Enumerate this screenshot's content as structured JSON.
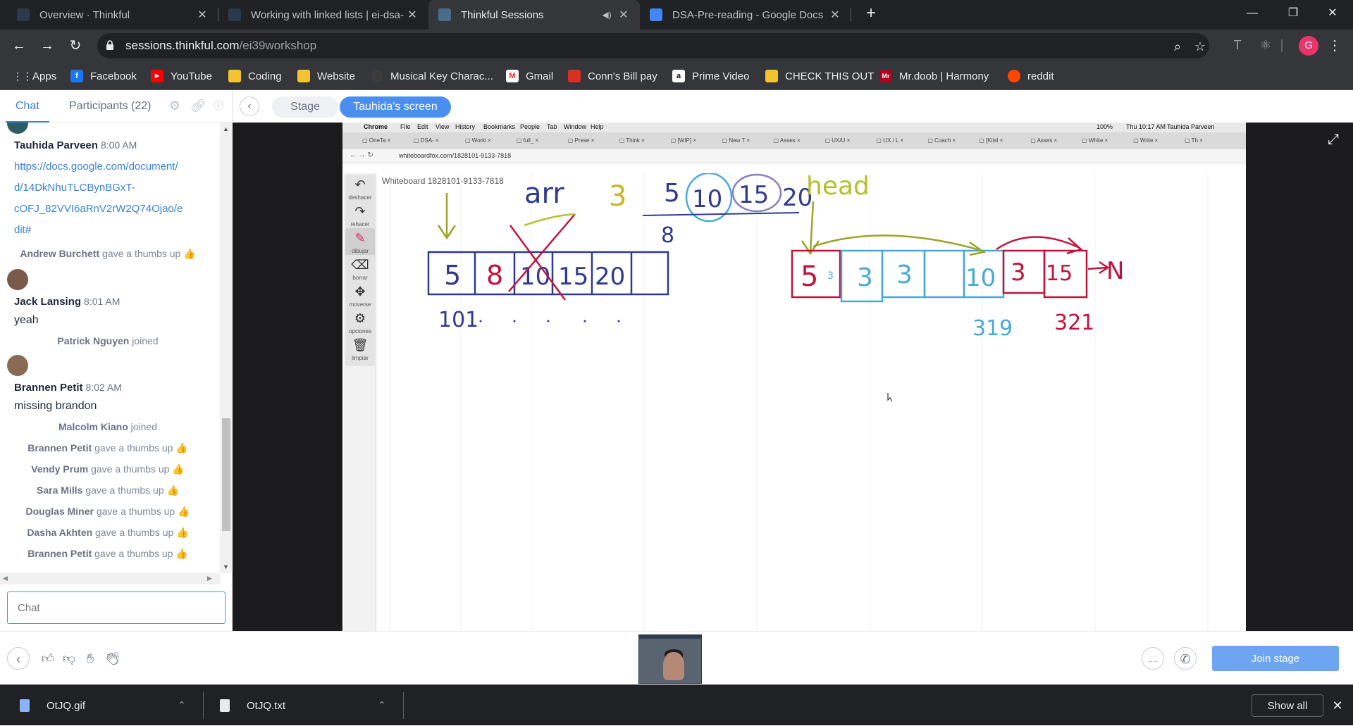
{
  "browser": {
    "tabs": [
      {
        "title": "Overview · Thinkful",
        "icon": "thinkful-favicon"
      },
      {
        "title": "Working with linked lists | ei-dsa-",
        "icon": "thinkful-favicon"
      },
      {
        "title": "Thinkful Sessions",
        "icon": "thinkful-favicon"
      },
      {
        "title": "DSA-Pre-reading - Google Docs",
        "icon": "google-docs-favicon"
      }
    ],
    "url_host": "sessions.thinkful.com",
    "url_path": "/ei39workshop",
    "bookmarks": [
      "Apps",
      "Facebook",
      "YouTube",
      "Coding",
      "Website",
      "Musical Key Charac...",
      "Gmail",
      "Conn's Bill pay",
      "Prime Video",
      "CHECK THIS OUT",
      "Mr.doob | Harmony",
      "reddit"
    ],
    "profile_initial": "G"
  },
  "chat": {
    "tab_chat": "Chat",
    "tab_participants": "Participants (22)",
    "messages": [
      {
        "name": "Tauhida Parveen",
        "time": "8:00 AM",
        "lines": [
          "https://docs.google.com/document/",
          "d/14DkNhuTLCBynBGxT-",
          "cOFJ_82VVI6aRnV2rW2Q74Ojao/e",
          "dit#"
        ]
      },
      {
        "name": "Jack Lansing",
        "time": "8:01 AM",
        "text": "yeah"
      },
      {
        "name": "Brannen Petit",
        "time": "8:02 AM",
        "text": "missing brandon"
      }
    ],
    "events": [
      {
        "name": "Andrew Burchett",
        "action": "gave a thumbs up 👍"
      },
      {
        "name": "Patrick Nguyen",
        "action": "joined"
      },
      {
        "name": "Malcolm Kiano",
        "action": "joined"
      },
      {
        "name": "Brannen Petit",
        "action": "gave a thumbs up 👍"
      },
      {
        "name": "Vendy Prum",
        "action": "gave a thumbs up 👍"
      },
      {
        "name": "Sara Mills",
        "action": "gave a thumbs up 👍"
      },
      {
        "name": "Douglas Miner",
        "action": "gave a thumbs up 👍"
      },
      {
        "name": "Dasha Akhten",
        "action": "gave a thumbs up 👍"
      },
      {
        "name": "Brannen Petit",
        "action": "gave a thumbs up 👍"
      }
    ],
    "input_placeholder": "Chat"
  },
  "stage": {
    "stage_label": "Stage",
    "screen_label": "Tauhida's screen",
    "remote": {
      "menubar": [
        "Chrome",
        "File",
        "Edit",
        "View",
        "History",
        "Bookmarks",
        "People",
        "Tab",
        "Window",
        "Help"
      ],
      "clock": "Thu 10:17 AM",
      "user": "Tauhida Parveen",
      "battery": "100%",
      "url": "whiteboardfox.com/1828101-9133-7818",
      "tabs": [
        "OneTa",
        "DSA-",
        "Worki",
        "full_",
        "Prese",
        "Think",
        "[WIP]",
        "New T",
        "Asses",
        "UX/U",
        "UX / L",
        "Coach",
        "[Kitsl",
        "Asses",
        "White",
        "Write",
        "Th"
      ],
      "whiteboard_title": "Whiteboard 1828101-9133-7818",
      "tools": [
        {
          "label": "deshacer",
          "icon": "undo-icon"
        },
        {
          "label": "rehacer",
          "icon": "redo-icon"
        },
        {
          "label": "dibujar",
          "icon": "pencil-icon"
        },
        {
          "label": "borrar",
          "icon": "eraser-icon"
        },
        {
          "label": "moverse",
          "icon": "move-icon"
        },
        {
          "label": "opciones",
          "icon": "gear-icon"
        },
        {
          "label": "limpiar",
          "icon": "trash-icon"
        }
      ],
      "handwriting": {
        "arr_label": "arr",
        "values": [
          "3",
          "5",
          "10",
          "15",
          "20"
        ],
        "below_line": "8",
        "head_label": "head",
        "array_cells": [
          "5",
          "8",
          "10",
          "15",
          "20"
        ],
        "index_label": "101",
        "list_nodes": [
          "5",
          "3",
          "3",
          "3",
          "10",
          "3",
          "15"
        ],
        "null_label": "N",
        "addr_a": "319",
        "addr_b": "321"
      }
    }
  },
  "actions": {
    "join_stage": "Join stage",
    "more": "...."
  },
  "downloads": {
    "items": [
      "OtJQ.gif",
      "OtJQ.txt"
    ],
    "show_all": "Show all"
  }
}
